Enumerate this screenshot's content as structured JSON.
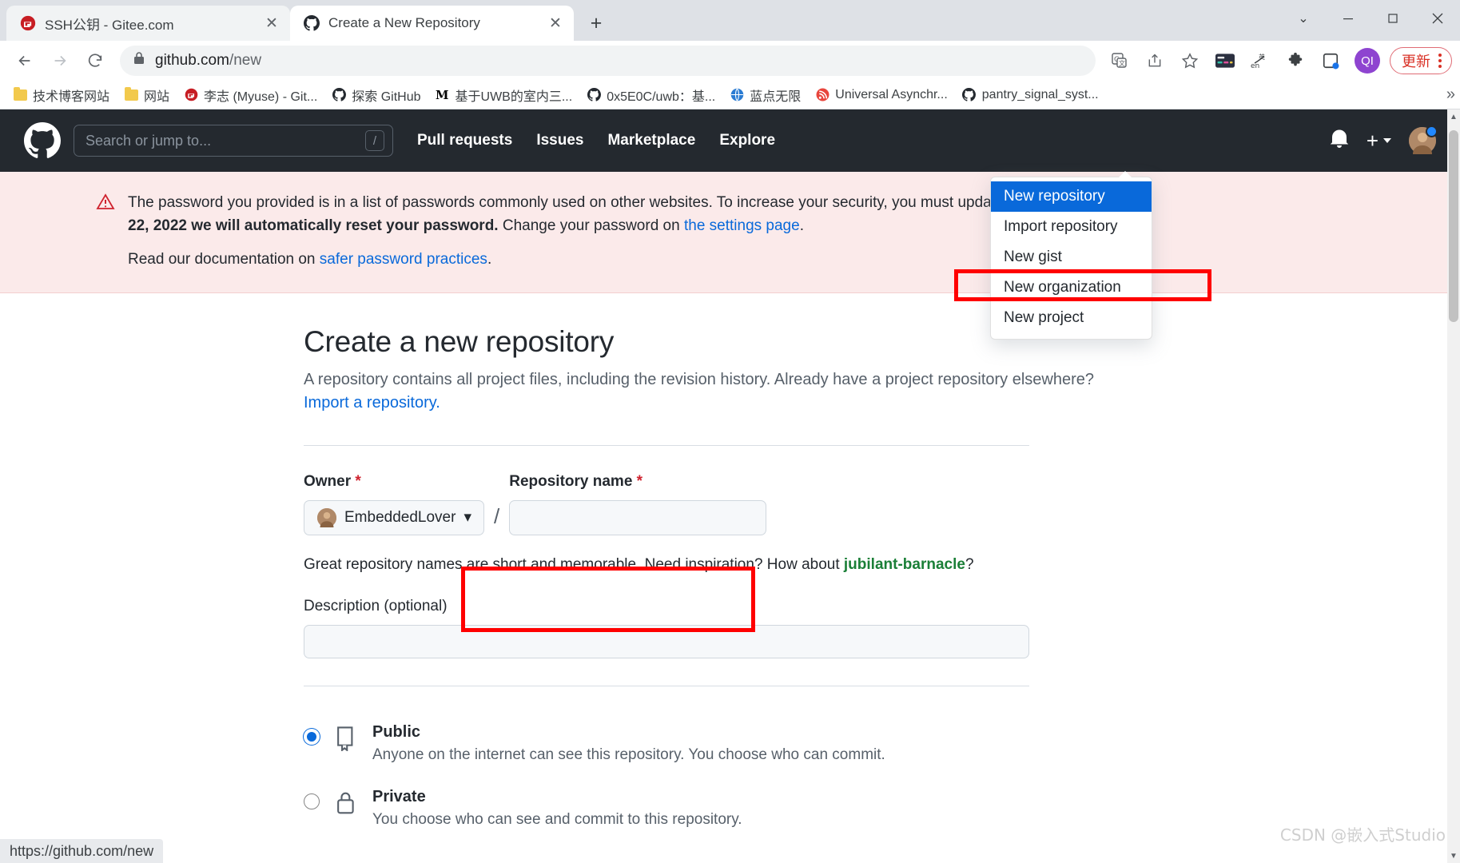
{
  "window": {
    "controls": {
      "minimize": "–",
      "maximize": "❐",
      "close": "✕",
      "tablist": "⌄"
    }
  },
  "tabs": [
    {
      "title": "SSH公钥 - Gitee.com",
      "favicon": "gitee-icon",
      "active": false,
      "close": "✕"
    },
    {
      "title": "Create a New Repository",
      "favicon": "github-icon",
      "active": true,
      "close": "✕"
    }
  ],
  "newtab_label": "+",
  "toolbar": {
    "back": "←",
    "forward": "→",
    "reload": "↻",
    "lock_icon": "lock-icon",
    "url_host": "github.com",
    "url_path": "/new",
    "icons": [
      {
        "name": "translate-icon",
        "glyph": "文"
      },
      {
        "name": "share-icon",
        "glyph": "↱"
      },
      {
        "name": "bookmark-star-icon",
        "glyph": "☆"
      },
      {
        "name": "extension-color-icon",
        "glyph": "▤"
      },
      {
        "name": "translate-en-icon",
        "glyph": "en"
      },
      {
        "name": "extensions-puzzle-icon",
        "glyph": "❖"
      },
      {
        "name": "side-panel-icon",
        "glyph": "◳"
      }
    ],
    "profile_initials": "QI",
    "update_label": "更新",
    "menu_icon": "kebab-menu-icon"
  },
  "bookmarks": {
    "items": [
      {
        "label": "技术博客网站",
        "icon": "folder-icon"
      },
      {
        "label": "网站",
        "icon": "folder-icon"
      },
      {
        "label": "李志 (Myuse) - Git...",
        "icon": "gitee-icon"
      },
      {
        "label": "探索 GitHub",
        "icon": "github-icon"
      },
      {
        "label": "基于UWB的室内三...",
        "icon": "medium-icon"
      },
      {
        "label": "0x5E0C/uwb：基...",
        "icon": "github-icon"
      },
      {
        "label": "蓝点无限",
        "icon": "globe-icon"
      },
      {
        "label": "Universal Asynchr...",
        "icon": "rss-icon"
      },
      {
        "label": "pantry_signal_syst...",
        "icon": "github-icon"
      }
    ],
    "overflow": "»"
  },
  "github_header": {
    "logo": "github-mark-icon",
    "search_placeholder": "Search or jump to...",
    "search_shortcut": "/",
    "nav": [
      {
        "label": "Pull requests"
      },
      {
        "label": "Issues"
      },
      {
        "label": "Marketplace"
      },
      {
        "label": "Explore"
      }
    ],
    "bell": "notifications-bell-icon",
    "plus": "+",
    "avatar": "user-avatar"
  },
  "dropdown": {
    "items": [
      {
        "label": "New repository",
        "selected": true
      },
      {
        "label": "Import repository",
        "selected": false
      },
      {
        "label": "New gist",
        "selected": false
      },
      {
        "label": "New organization",
        "selected": false
      },
      {
        "label": "New project",
        "selected": false
      }
    ]
  },
  "flash": {
    "icon": "alert-triangle-icon",
    "line1_a": "The password you provided is in a list of passwords commonly used on other websites. To increase your security, you must update your ",
    "line2_bold": "22, 2022 we will automatically reset your password.",
    "line2_rest": " Change your password on ",
    "line2_link": "the settings page",
    "line2_end": ".",
    "sub_text": "Read our documentation on ",
    "sub_link": "safer password practices",
    "sub_end": "."
  },
  "main": {
    "heading": "Create a new repository",
    "lede_a": "A repository contains all project files, including the revision history. Already have a project repository elsewhere?",
    "lede_link": "Import a repository.",
    "owner": {
      "label": "Owner",
      "required": "*",
      "value": "EmbeddedLover",
      "caret": "▾"
    },
    "separator": "/",
    "repo_name": {
      "label": "Repository name",
      "required": "*",
      "value": "",
      "placeholder": ""
    },
    "hint_pre": "Great repository names are short and memorable. Need inspiration? How about ",
    "hint_suggestion": "jubilant-barnacle",
    "hint_post": "?",
    "description": {
      "label": "Description",
      "optional": "(optional)",
      "value": "",
      "placeholder": ""
    },
    "visibility": [
      {
        "id": "public",
        "icon": "repo-book-icon",
        "title": "Public",
        "desc": "Anyone on the internet can see this repository. You choose who can commit.",
        "selected": true
      },
      {
        "id": "private",
        "icon": "lock-icon",
        "title": "Private",
        "desc": "You choose who can see and commit to this repository.",
        "selected": false
      }
    ]
  },
  "status_bar": {
    "url": "https://github.com/new"
  },
  "watermark": {
    "text": "CSDN @嵌入式Studio"
  },
  "colors": {
    "accent_blue": "#0969da",
    "annotation_red": "#ff0000",
    "flash_bg": "#fbeaea",
    "header_dark": "#24292f",
    "suggestion_green": "#1a7f37"
  }
}
